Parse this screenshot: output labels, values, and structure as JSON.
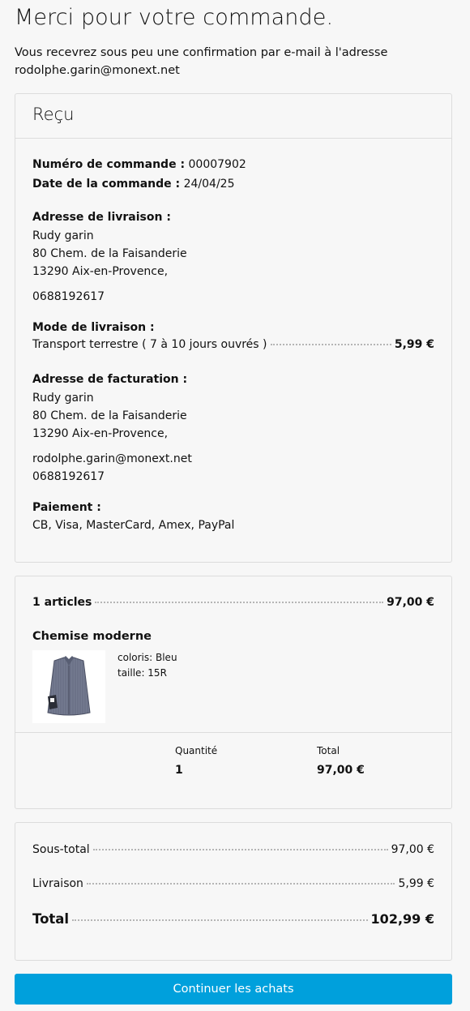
{
  "header": {
    "title": "Merci pour votre commande.",
    "confirmation_line1": "Vous recevrez sous peu une confirmation par e-mail à l'adresse",
    "confirmation_email": "rodolphe.garin@monext.net"
  },
  "receipt": {
    "title": "Reçu",
    "order_number_label": "Numéro de commande :",
    "order_number": "00007902",
    "order_date_label": "Date de la commande :",
    "order_date": "24/04/25",
    "shipping_address_label": "Adresse de livraison :",
    "shipping_address": {
      "name": "Rudy garin",
      "street": "80 Chem. de la Faisanderie",
      "city": "13290 Aix-en-Provence,",
      "phone": "0688192617"
    },
    "shipping_mode_label": "Mode de livraison :",
    "shipping_mode": "Transport terrestre ( 7 à 10 jours ouvrés )",
    "shipping_price": "5,99 €",
    "billing_address_label": "Adresse de facturation :",
    "billing_address": {
      "name": "Rudy garin",
      "street": "80 Chem. de la Faisanderie",
      "city": "13290 Aix-en-Provence,",
      "email": "rodolphe.garin@monext.net",
      "phone": "0688192617"
    },
    "payment_label": "Paiement :",
    "payment_methods": "CB, Visa, MasterCard, Amex, PayPal"
  },
  "articles": {
    "count_label": "1 articles",
    "count_total": "97,00 €",
    "product": {
      "name": "Chemise moderne",
      "image_icon": "shirt-icon",
      "color": "coloris: Bleu",
      "size": "taille: 15R"
    },
    "quantity_label": "Quantité",
    "quantity": "1",
    "total_label": "Total",
    "total": "97,00 €"
  },
  "totals": {
    "subtotal_label": "Sous-total",
    "subtotal": "97,00 €",
    "shipping_label": "Livraison",
    "shipping": "5,99 €",
    "total_label": "Total",
    "total": "102,99 €"
  },
  "actions": {
    "continue_label": "Continuer les achats"
  },
  "colors": {
    "accent": "#00a0dc",
    "background": "#f7f7f7",
    "border": "#dcdcdc"
  }
}
